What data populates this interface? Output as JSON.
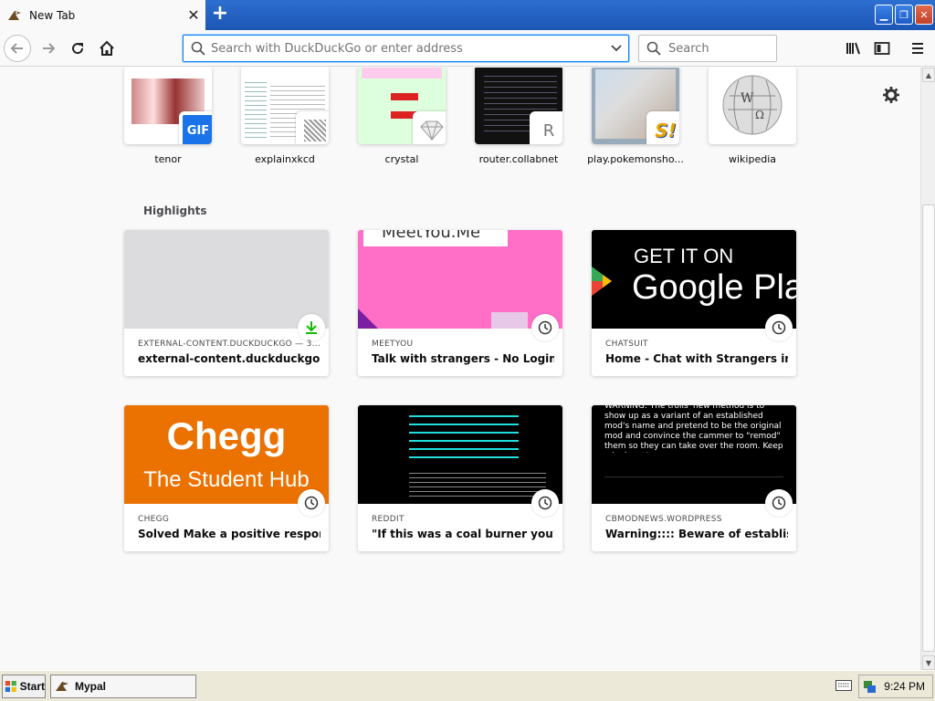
{
  "tab": {
    "title": "New Tab",
    "close": "✕"
  },
  "newtab": "+",
  "window_buttons": {
    "minimize": "▁",
    "restore": "❐",
    "close": "✕"
  },
  "urlbar": {
    "placeholder": "Search with DuckDuckGo or enter address",
    "value": ""
  },
  "searchbar": {
    "placeholder": "Search"
  },
  "top_sites": [
    {
      "label": "tenor",
      "icon_text": "GIF"
    },
    {
      "label": "explainxkcd",
      "icon_text": ""
    },
    {
      "label": "crystal",
      "icon_text": ""
    },
    {
      "label": "router.collabnet",
      "icon_text": "R"
    },
    {
      "label": "play.pokemonsho...",
      "icon_text": "S!"
    },
    {
      "label": "wikipedia",
      "icon_text": ""
    }
  ],
  "highlights": {
    "title": "Highlights",
    "cards": [
      {
        "source": "EXTERNAL-CONTENT.DUCKDUCKGO — 3...",
        "title": "external-content.duckduckgo.c...",
        "badge": "download-icon"
      },
      {
        "source": "MEETYOU",
        "title": "Talk with strangers - No Login - ...",
        "badge": "clock-icon",
        "image_text": "MeetYou.Me"
      },
      {
        "source": "CHATSUIT",
        "title": "Home - Chat with Strangers in fr...",
        "badge": "clock-icon",
        "image_text_1": "GET IT ON",
        "image_text_2": "Google Pla"
      },
      {
        "source": "CHEGG",
        "title": "Solved Make a positive response...",
        "badge": "clock-icon",
        "image_text_1": "Chegg",
        "image_text_2": "The Student Hub"
      },
      {
        "source": "REDDIT",
        "title": "\"If this was a coal burner you'll fi...",
        "badge": "clock-icon"
      },
      {
        "source": "CBMODNEWS.WORDPRESS",
        "title": "Warning:::: Beware of establishe...",
        "badge": "clock-icon",
        "image_text": "WARNING: The trolls' new method is to show up as a variant of an established mod's name and pretend to be the original mod and convince the cammer to \"remod\" them so they can take over the room. Keep a look out!"
      }
    ]
  },
  "taskbar": {
    "start": "Start",
    "app": "Mypal",
    "time": "9:24 PM"
  },
  "colors": {
    "accent": "#0a84ff",
    "titlebar": "#1c56b5",
    "chegg": "#eb7100",
    "meetyou": "#ff6fc8",
    "download": "#12bc00"
  }
}
